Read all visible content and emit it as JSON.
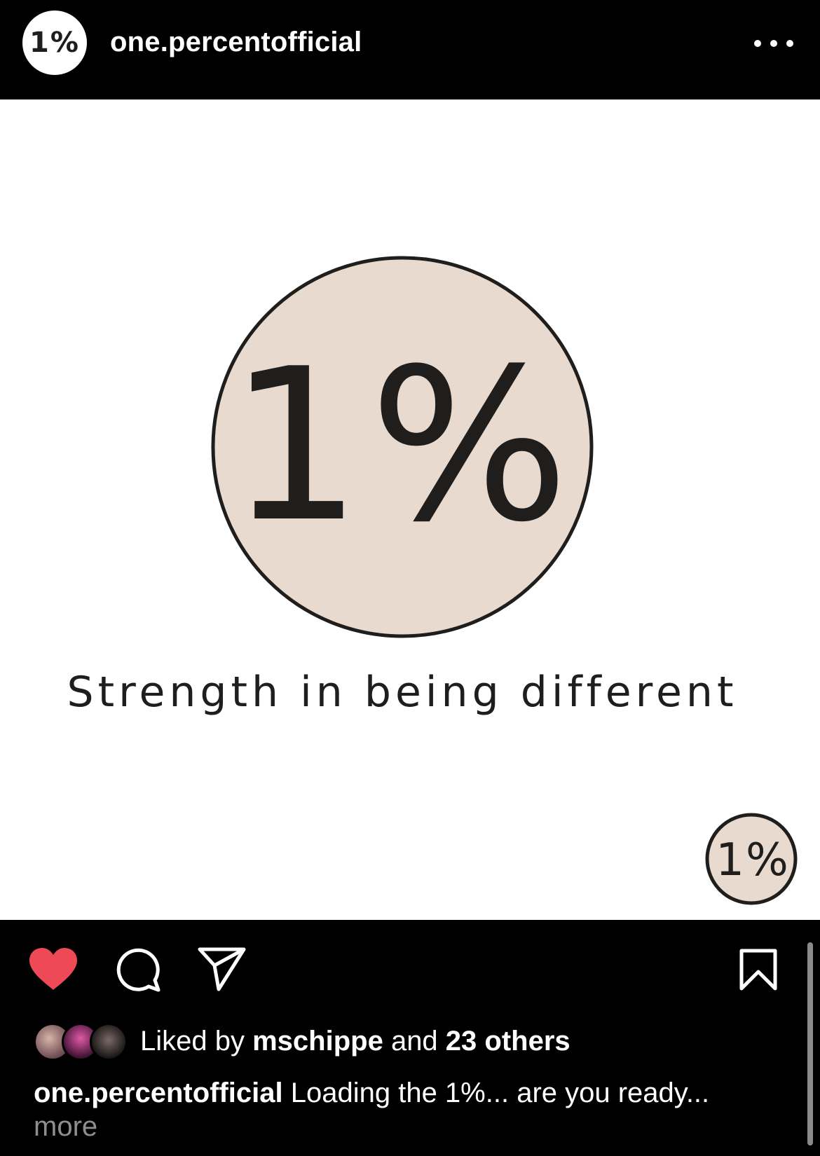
{
  "header": {
    "avatar_text": "1%",
    "username": "one.percentofficial"
  },
  "post_image": {
    "logo_text": "1%",
    "tagline": "Strength in being different",
    "watermark_text": "1%",
    "colors": {
      "circle_fill": "#e8dace",
      "ink": "#1f1e1c",
      "background": "#ffffff"
    }
  },
  "actions": {
    "like_icon": "heart-icon",
    "comment_icon": "comment-icon",
    "share_icon": "paper-plane-icon",
    "save_icon": "bookmark-icon",
    "like_color": "#ed4956"
  },
  "likes": {
    "prefix": "Liked by ",
    "user": "mschippe",
    "middle": " and ",
    "others": "23 others"
  },
  "caption": {
    "username": "one.percentofficial",
    "text": " Loading the 1%... are you ready...",
    "more": "more"
  }
}
